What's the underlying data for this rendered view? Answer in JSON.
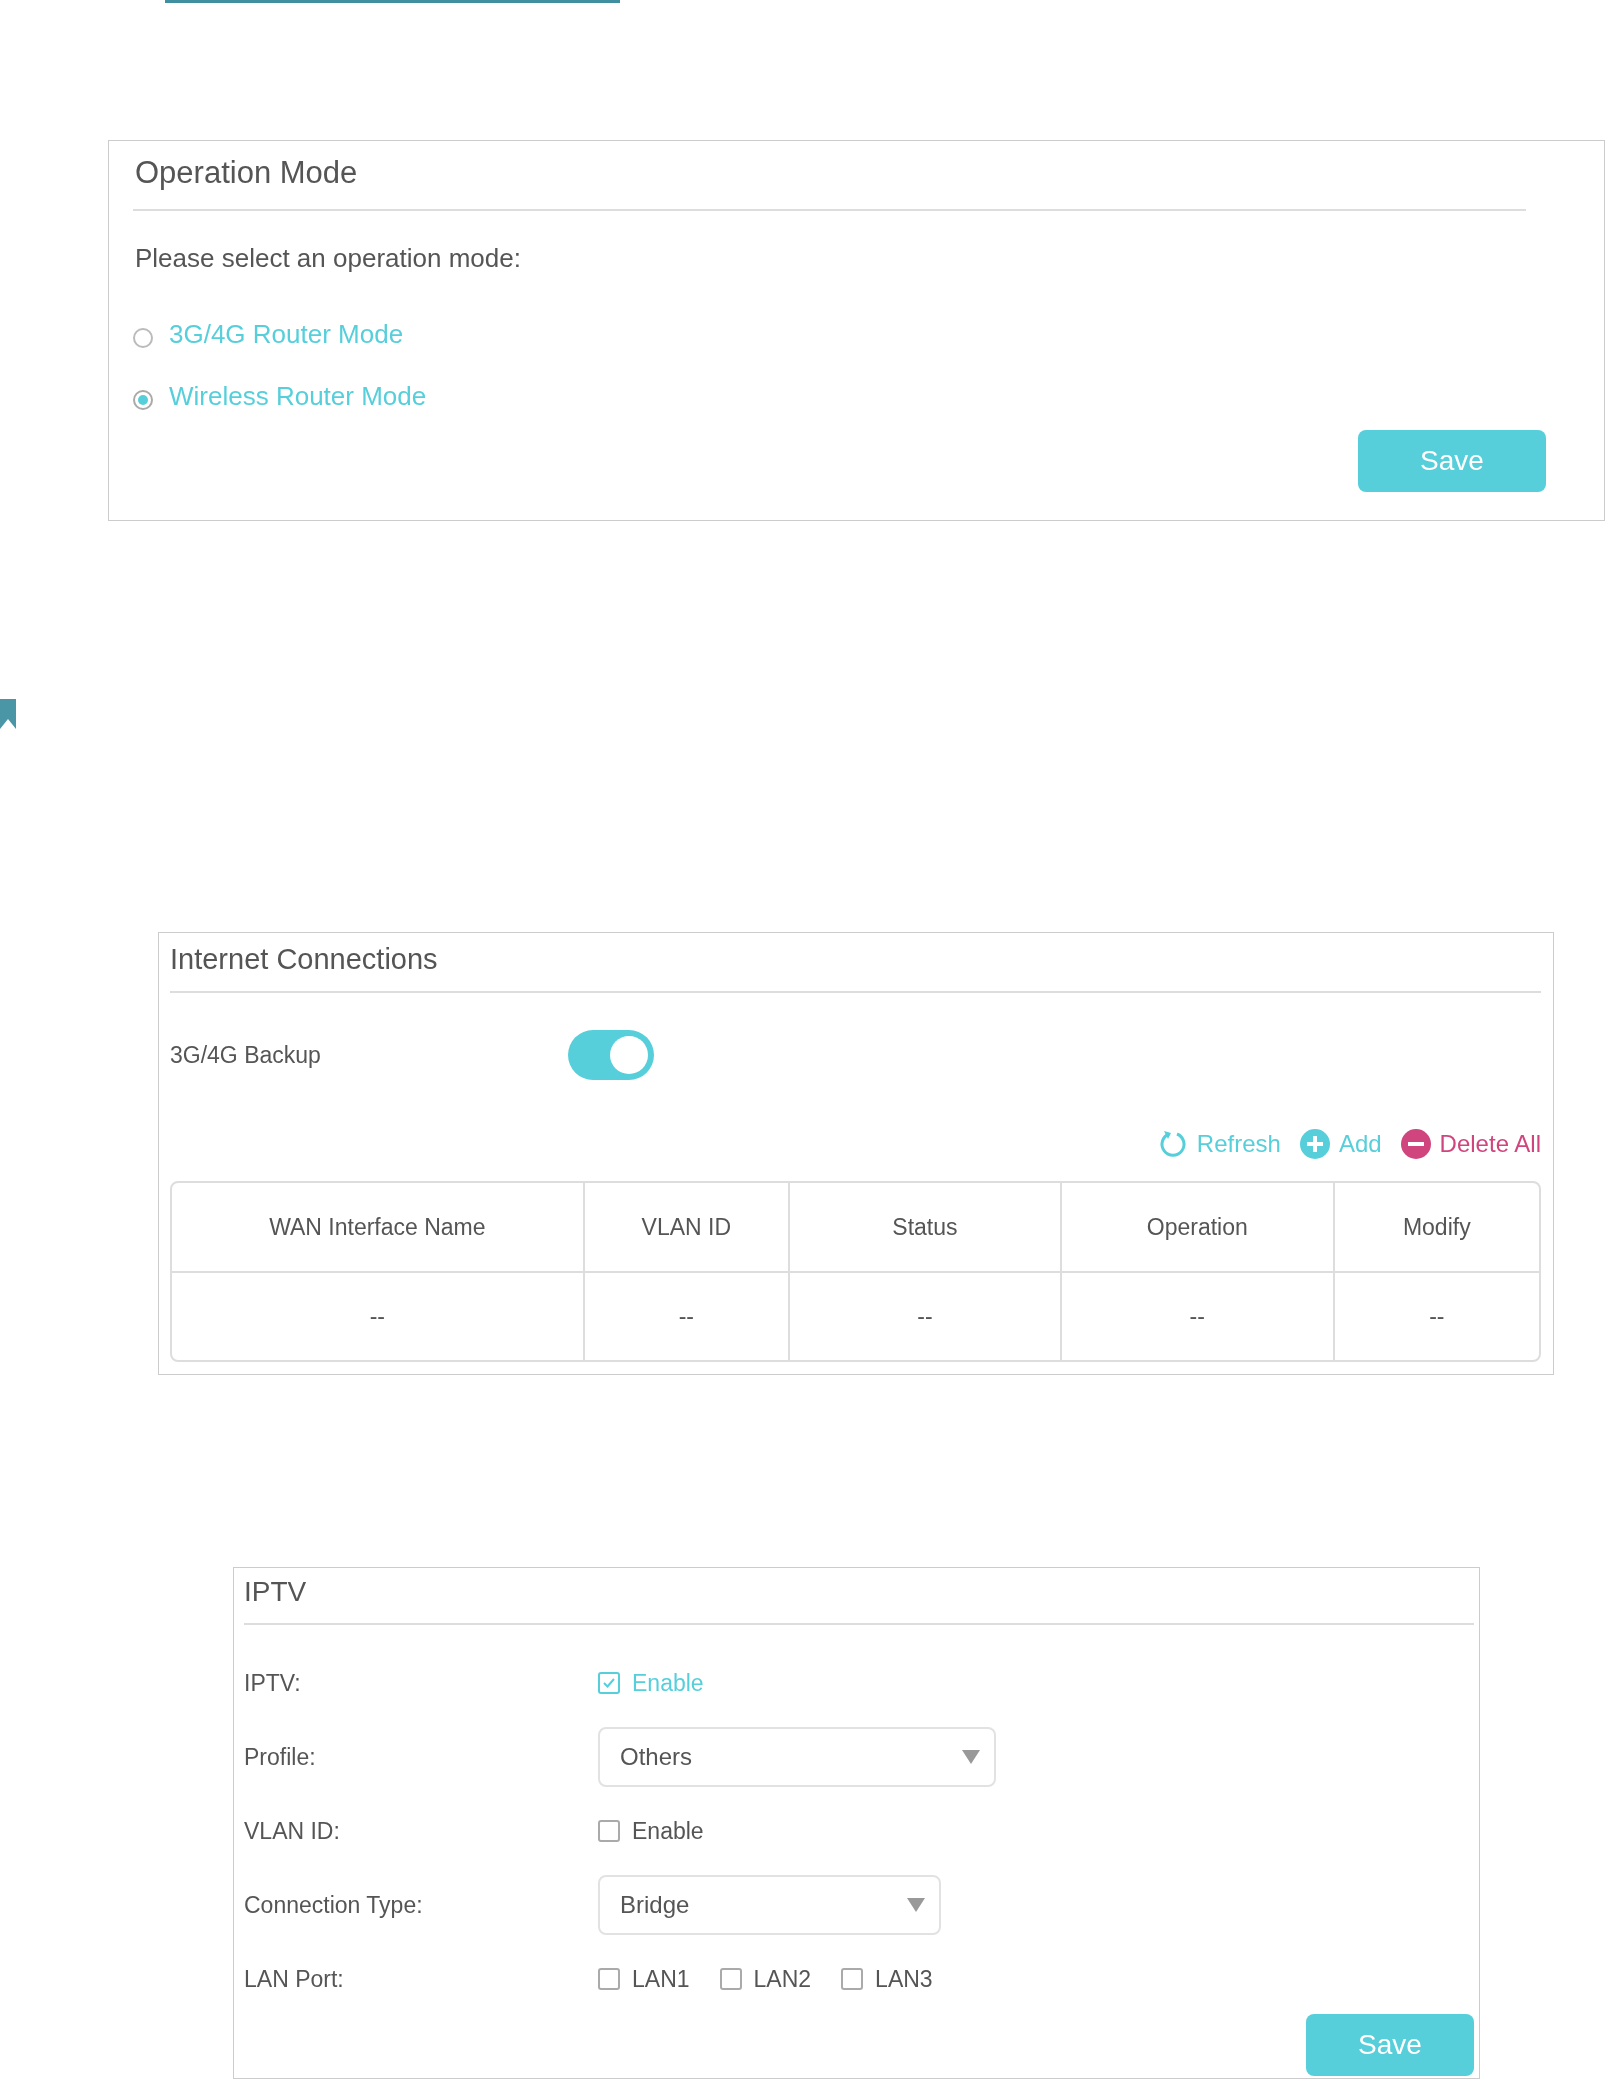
{
  "operation_mode": {
    "title": "Operation Mode",
    "prompt": "Please select an operation mode:",
    "options": [
      {
        "label": "3G/4G Router Mode",
        "selected": false
      },
      {
        "label": "Wireless Router Mode",
        "selected": true
      }
    ],
    "save_button": "Save"
  },
  "internet_connections": {
    "title": "Internet Connections",
    "backup": {
      "label": "3G/4G Backup",
      "on": true
    },
    "toolbar": [
      {
        "kind": "refresh",
        "label": "Refresh"
      },
      {
        "kind": "add",
        "label": "Add"
      },
      {
        "kind": "delete",
        "label": "Delete All"
      }
    ],
    "table": {
      "columns": [
        "WAN Interface Name",
        "VLAN ID",
        "Status",
        "Operation",
        "Modify"
      ],
      "rows": [
        [
          "--",
          "--",
          "--",
          "--",
          "--"
        ]
      ]
    }
  },
  "iptv": {
    "title": "IPTV",
    "rows": [
      {
        "kind": "checkbox",
        "label": "IPTV:",
        "options": [
          {
            "label": "Enable",
            "checked": true
          }
        ]
      },
      {
        "kind": "select",
        "label": "Profile:",
        "value": "Others"
      },
      {
        "kind": "checkbox",
        "label": "VLAN ID:",
        "options": [
          {
            "label": "Enable",
            "checked": false
          }
        ]
      },
      {
        "kind": "select",
        "label": "Connection Type:",
        "value": "Bridge"
      },
      {
        "kind": "checkbox",
        "label": "LAN Port:",
        "options": [
          {
            "label": "LAN1",
            "checked": false
          },
          {
            "label": "LAN2",
            "checked": false
          },
          {
            "label": "LAN3",
            "checked": false
          }
        ]
      }
    ],
    "save_button": "Save"
  }
}
